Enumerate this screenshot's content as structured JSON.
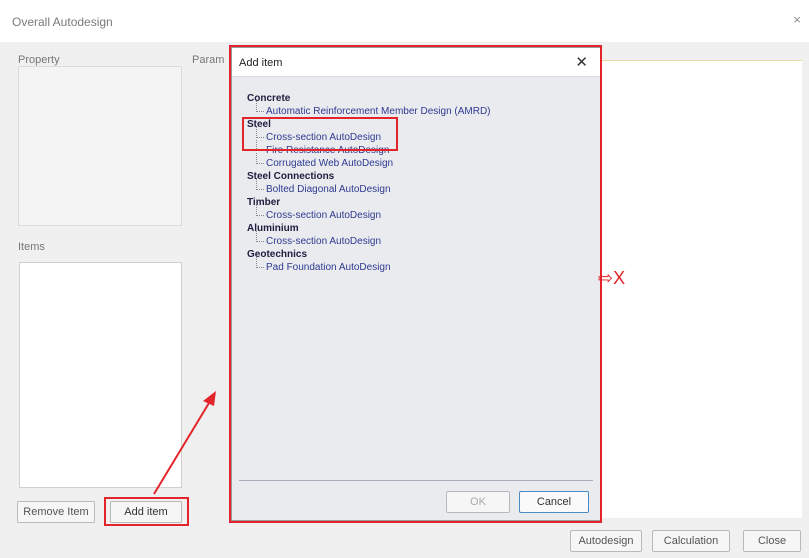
{
  "window": {
    "title": "Overall Autodesign",
    "close_glyph": "×"
  },
  "labels": {
    "property": "Property",
    "params": "Param",
    "items": "Items"
  },
  "buttons": {
    "remove_item": "Remove Item",
    "add_item": "Add item",
    "autodesign": "Autodesign",
    "calculation": "Calculation",
    "close": "Close"
  },
  "dialog": {
    "title": "Add item",
    "close_glyph": "✕",
    "ok": "OK",
    "cancel": "Cancel",
    "tree": [
      {
        "category": "Concrete",
        "items": [
          "Automatic Reinforcement Member Design (AMRD)"
        ]
      },
      {
        "category": "Steel",
        "items": [
          "Cross-section AutoDesign",
          "Fire Resistance AutoDesign",
          "Corrugated Web AutoDesign"
        ]
      },
      {
        "category": "Steel Connections",
        "items": [
          "Bolted Diagonal AutoDesign"
        ]
      },
      {
        "category": "Timber",
        "items": [
          "Cross-section AutoDesign"
        ]
      },
      {
        "category": "Aluminium",
        "items": [
          "Cross-section AutoDesign"
        ]
      },
      {
        "category": "Geotechnics",
        "items": [
          "Pad Foundation AutoDesign"
        ]
      }
    ]
  },
  "annotations": {
    "x_mark": "⇨X",
    "highlight_color": "#e3242b"
  }
}
